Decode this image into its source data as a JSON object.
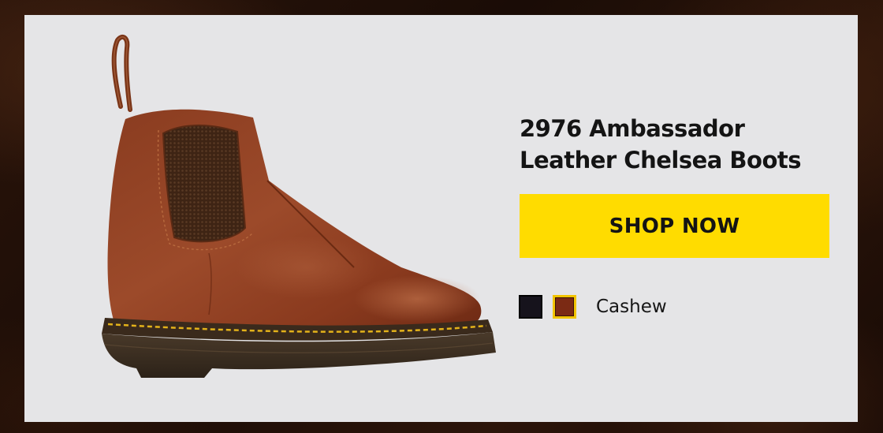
{
  "product": {
    "title_line1": "2976 Ambassador",
    "title_line2": "Leather Chelsea Boots",
    "image_icon": "chelsea-boot-image"
  },
  "cta": {
    "label": "SHOP NOW",
    "color": "#ffdc00"
  },
  "colors": {
    "options": [
      {
        "name": "black",
        "hex": "#16131c"
      },
      {
        "name": "cashew",
        "hex": "#7b2a14"
      }
    ],
    "selected_label": "Cashew",
    "selected_outline": "#f2c400"
  }
}
